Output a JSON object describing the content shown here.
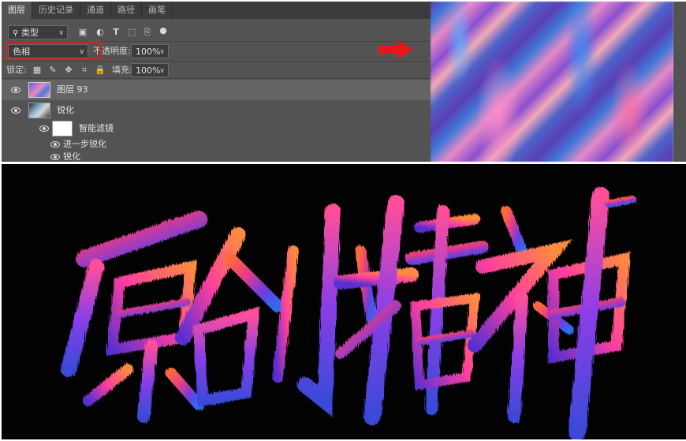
{
  "panel": {
    "tabs": [
      {
        "label": "图层",
        "active": true
      },
      {
        "label": "历史记录",
        "active": false
      },
      {
        "label": "通道",
        "active": false
      },
      {
        "label": "路径",
        "active": false
      },
      {
        "label": "画笔",
        "active": false
      }
    ],
    "filter": {
      "label": "类型"
    },
    "blend_mode": {
      "value": "色相",
      "highlight_color": "#e11b1b"
    },
    "opacity": {
      "label": "不透明度:",
      "value": "100%"
    },
    "lock": {
      "label": "锁定:"
    },
    "fill": {
      "label": "填充:",
      "value": "100%"
    },
    "layers": [
      {
        "name": "图层 93",
        "selected": true
      },
      {
        "name": "锐化",
        "selected": false
      },
      {
        "name": "智能滤镜",
        "selected": false
      },
      {
        "name": "进一步锐化",
        "selected": false
      },
      {
        "name": "锐化",
        "selected": false
      }
    ]
  },
  "annotation_arrow": {
    "color": "#e8161b"
  },
  "artwork": {
    "glyphs": [
      "原",
      "创",
      "精",
      "神"
    ],
    "background": "#020202"
  }
}
